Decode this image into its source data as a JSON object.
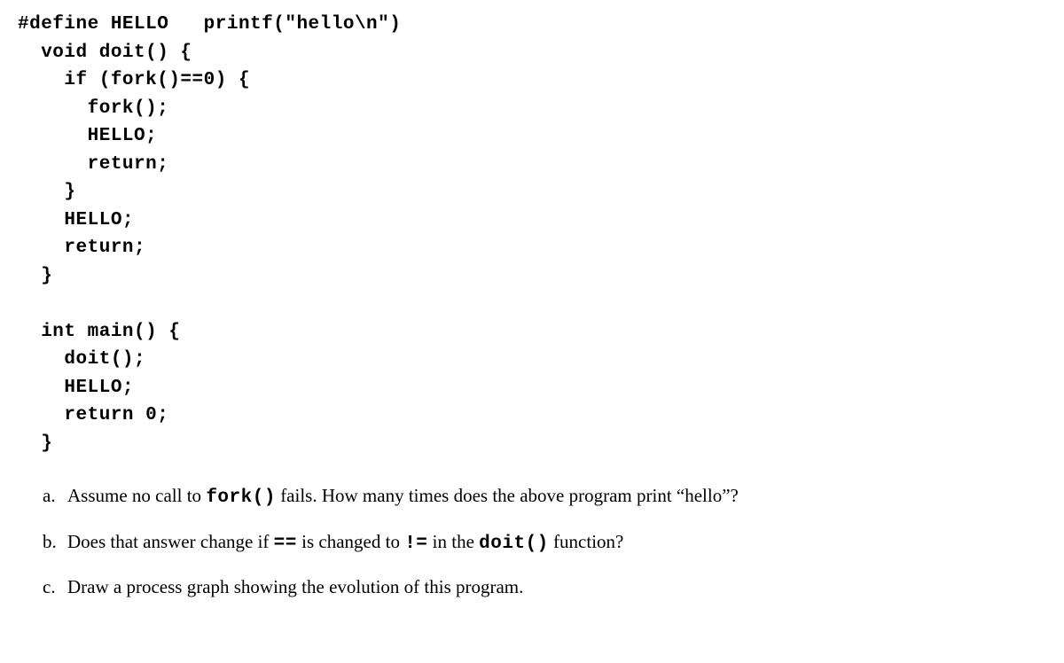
{
  "code": {
    "lines": [
      "#define HELLO   printf(\"hello\\n\")",
      "  void doit() {",
      "    if (fork()==0) {",
      "      fork();",
      "      HELLO;",
      "      return;",
      "    }",
      "    HELLO;",
      "    return;",
      "  }",
      "",
      "  int main() {",
      "    doit();",
      "    HELLO;",
      "    return 0;",
      "  }"
    ]
  },
  "questions": {
    "a": {
      "label": "a.",
      "pre": "Assume no call to ",
      "code1": "fork()",
      "mid": " fails.  How many times does the above program print  “hello”?"
    },
    "b": {
      "label": "b.",
      "pre": "Does that answer change if ",
      "code1": "==",
      "mid": " is changed to ",
      "code2": "!=",
      "mid2": " in the ",
      "code3": "doit()",
      "post": " function?"
    },
    "c": {
      "label": "c.",
      "text": "Draw a process graph showing the evolution of this program."
    }
  }
}
